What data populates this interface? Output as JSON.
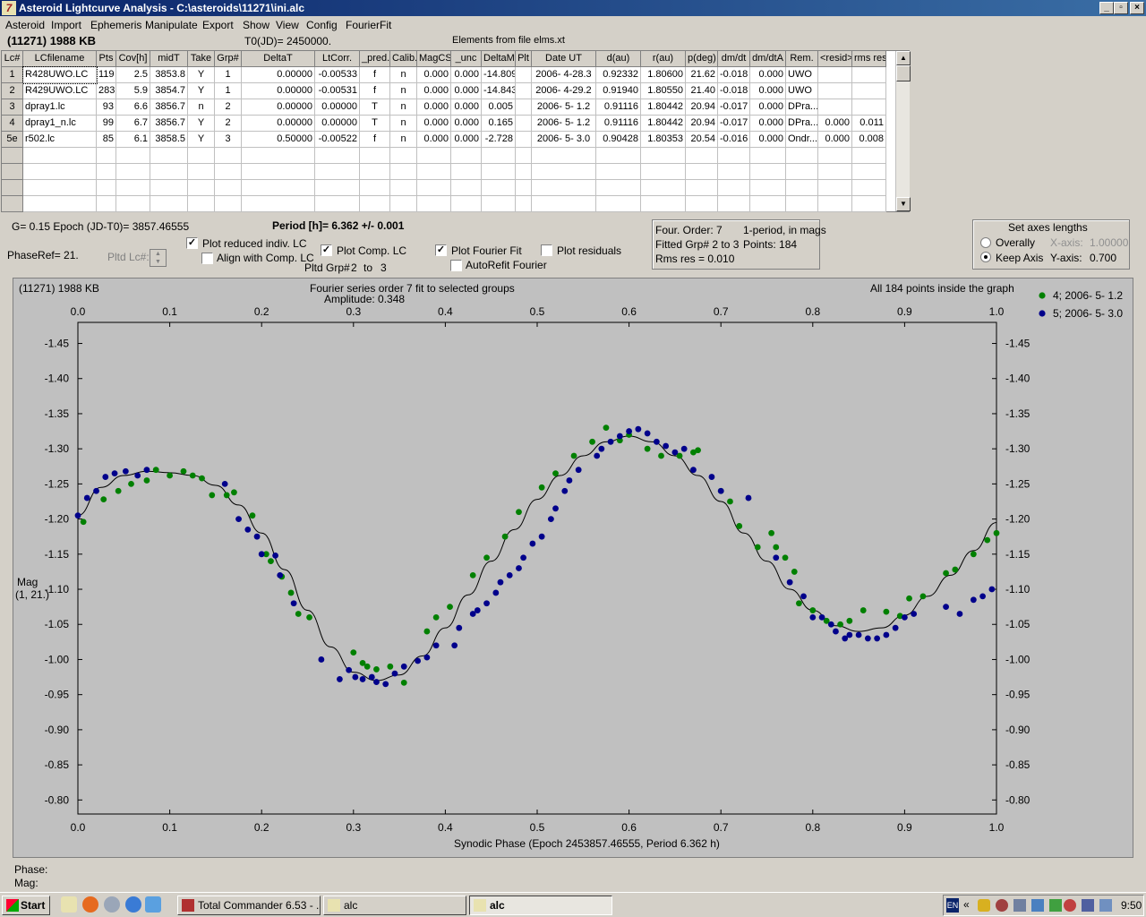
{
  "window": {
    "title": "Asteroid Lightcurve Analysis - C:\\asteroids\\11271\\ini.alc",
    "icon_glyph": "7",
    "btn_min": "_",
    "btn_max": "▫",
    "btn_close": "×"
  },
  "menu": [
    "Asteroid",
    "Import",
    "Ephemeris",
    "Manipulate",
    "Export",
    "Show",
    "View",
    "Config",
    "FourierFit"
  ],
  "header": {
    "object": "(11271) 1988 KB",
    "t0": "T0(JD)= 2450000.",
    "elements": "Elements from file elms.xt"
  },
  "table": {
    "columns": [
      "Lc#",
      "LCfilename",
      "Pts",
      "Cov[h]",
      "midT",
      "Take",
      "Grp#",
      "DeltaT",
      "LtCorr.",
      "_pred.",
      "Calib.",
      "MagCS",
      "_unc",
      "DeltaM",
      "Plt",
      "Date UT",
      "d(au)",
      "r(au)",
      "p(deg)",
      "dm/dt",
      "dm/dtA",
      "Rem.",
      "<resid>",
      "rms res"
    ],
    "rows": [
      [
        "1",
        "R428UWO.LC",
        "119",
        "2.5",
        "3853.8",
        "Y",
        "1",
        "0.00000",
        "-0.00533",
        "f",
        "n",
        "0.000",
        "0.000",
        "-14.809",
        "",
        "2006- 4-28.3",
        "0.92332",
        "1.80600",
        "21.62",
        "-0.018",
        "0.000",
        "UWO",
        "",
        ""
      ],
      [
        "2",
        "R429UWO.LC",
        "283",
        "5.9",
        "3854.7",
        "Y",
        "1",
        "0.00000",
        "-0.00531",
        "f",
        "n",
        "0.000",
        "0.000",
        "-14.843",
        "",
        "2006- 4-29.2",
        "0.91940",
        "1.80550",
        "21.40",
        "-0.018",
        "0.000",
        "UWO",
        "",
        ""
      ],
      [
        "3",
        "dpray1.lc",
        "93",
        "6.6",
        "3856.7",
        "n",
        "2",
        "0.00000",
        "0.00000",
        "T",
        "n",
        "0.000",
        "0.000",
        "0.005",
        "",
        "2006- 5- 1.2",
        "0.91116",
        "1.80442",
        "20.94",
        "-0.017",
        "0.000",
        "DPra...",
        "",
        ""
      ],
      [
        "4",
        "dpray1_n.lc",
        "99",
        "6.7",
        "3856.7",
        "Y",
        "2",
        "0.00000",
        "0.00000",
        "T",
        "n",
        "0.000",
        "0.000",
        "0.165",
        "",
        "2006- 5- 1.2",
        "0.91116",
        "1.80442",
        "20.94",
        "-0.017",
        "0.000",
        "DPra...",
        "0.000",
        "0.011"
      ],
      [
        "5e",
        "r502.lc",
        "85",
        "6.1",
        "3858.5",
        "Y",
        "3",
        "0.50000",
        "-0.00522",
        "f",
        "n",
        "0.000",
        "0.000",
        "-2.728",
        "",
        "2006- 5- 3.0",
        "0.90428",
        "1.80353",
        "20.54",
        "-0.016",
        "0.000",
        "Ondr...",
        "0.000",
        "0.008"
      ]
    ]
  },
  "controls": {
    "g_epoch": "G= 0.15    Epoch (JD-T0)= 3857.46555",
    "period": "Period [h]= 6.362 +/- 0.001",
    "phaseref": "PhaseRef= 21.",
    "pltd_lc": "Pltd Lc#:",
    "plot_reduced": "Plot reduced indiv. LC",
    "align_comp": "Align with Comp. LC",
    "plot_comp": "Plot Comp. LC",
    "pltd_grp": "Pltd Grp#",
    "grp_from": "2",
    "grp_to_word": "to",
    "grp_to": "3",
    "plot_fourier": "Plot Fourier Fit",
    "autorefit": "AutoRefit Fourier",
    "plot_residuals": "Plot residuals",
    "check_mark": "✓"
  },
  "fourier_box": {
    "order": "Four. Order:  7",
    "period_mode": "1-period, in mags",
    "fitted": "Fitted Grp# 2 to 3",
    "points": "Points: 184",
    "rms": "Rms res      = 0.010"
  },
  "axes_box": {
    "title": "Set axes lengths",
    "overally": "Overally",
    "keep_axis": "Keep Axis",
    "x_axis_label": "X-axis:",
    "x_axis_value": "1.00000",
    "y_axis_label": "Y-axis:",
    "y_axis_value": "0.700"
  },
  "plot_text": {
    "object": "(11271) 1988 KB",
    "fit_title": "Fourier series order 7 fit to selected groups",
    "amplitude": "Amplitude: 0.348",
    "inside": "All 184 points inside the graph",
    "y_label_1": "Mag",
    "y_label_2": "(1, 21.)",
    "x_label": "Synodic Phase (Epoch 2453857.46555, Period 6.362 h)"
  },
  "readout": {
    "phase": "Phase:",
    "mag": "Mag:"
  },
  "chart_data": {
    "type": "scatter",
    "title": "Fourier series order 7 fit to selected groups",
    "xlabel": "Synodic Phase (Epoch 2453857.46555, Period 6.362 h)",
    "ylabel": "Mag (1, 21.)",
    "xlim": [
      0.0,
      1.0
    ],
    "ylim": [
      -1.48,
      -0.78
    ],
    "y_inverted": true,
    "x_ticks": [
      "0.0",
      "0.1",
      "0.2",
      "0.3",
      "0.4",
      "0.5",
      "0.6",
      "0.7",
      "0.8",
      "0.9",
      "1.0"
    ],
    "y_ticks": [
      "-1.45",
      "-1.40",
      "-1.35",
      "-1.30",
      "-1.25",
      "-1.20",
      "-1.15",
      "-1.10",
      "-1.05",
      "-1.00",
      "-0.95",
      "-0.90",
      "-0.85",
      "-0.80"
    ],
    "grid": false,
    "legend_position": "top-right",
    "series": [
      {
        "name": "4; 2006- 5- 1.2",
        "color": "#008000",
        "x": [
          0.006,
          0.028,
          0.044,
          0.058,
          0.075,
          0.085,
          0.1,
          0.115,
          0.125,
          0.135,
          0.146,
          0.162,
          0.17,
          0.19,
          0.205,
          0.21,
          0.222,
          0.232,
          0.24,
          0.252,
          0.3,
          0.31,
          0.315,
          0.325,
          0.34,
          0.355,
          0.38,
          0.39,
          0.405,
          0.43,
          0.445,
          0.465,
          0.48,
          0.505,
          0.52,
          0.54,
          0.56,
          0.575,
          0.59,
          0.6,
          0.62,
          0.635,
          0.655,
          0.67,
          0.675,
          0.7,
          0.71,
          0.72,
          0.74,
          0.755,
          0.76,
          0.77,
          0.78,
          0.785,
          0.8,
          0.815,
          0.83,
          0.84,
          0.855,
          0.88,
          0.895,
          0.905,
          0.92,
          0.945,
          0.955,
          0.975,
          0.99,
          1.0
        ],
        "y": [
          -1.196,
          -1.228,
          -1.24,
          -1.25,
          -1.255,
          -1.27,
          -1.262,
          -1.268,
          -1.262,
          -1.258,
          -1.234,
          -1.234,
          -1.238,
          -1.205,
          -1.15,
          -1.14,
          -1.118,
          -1.095,
          -1.065,
          -1.06,
          -1.01,
          -0.995,
          -0.99,
          -0.986,
          -0.99,
          -0.967,
          -1.04,
          -1.06,
          -1.075,
          -1.12,
          -1.145,
          -1.175,
          -1.21,
          -1.245,
          -1.265,
          -1.29,
          -1.31,
          -1.33,
          -1.312,
          -1.32,
          -1.3,
          -1.29,
          -1.29,
          -1.295,
          -1.298,
          -1.24,
          -1.225,
          -1.19,
          -1.16,
          -1.18,
          -1.16,
          -1.145,
          -1.125,
          -1.08,
          -1.07,
          -1.055,
          -1.05,
          -1.055,
          -1.07,
          -1.068,
          -1.062,
          -1.087,
          -1.09,
          -1.123,
          -1.128,
          -1.15,
          -1.17,
          -1.18
        ]
      },
      {
        "name": "5; 2006- 5- 3.0",
        "color": "#00008b",
        "x": [
          0.0,
          0.01,
          0.02,
          0.03,
          0.04,
          0.052,
          0.065,
          0.075,
          0.16,
          0.175,
          0.185,
          0.195,
          0.2,
          0.215,
          0.22,
          0.235,
          0.265,
          0.285,
          0.295,
          0.302,
          0.31,
          0.32,
          0.325,
          0.335,
          0.345,
          0.355,
          0.37,
          0.38,
          0.39,
          0.41,
          0.415,
          0.43,
          0.435,
          0.445,
          0.455,
          0.46,
          0.47,
          0.48,
          0.485,
          0.495,
          0.505,
          0.515,
          0.52,
          0.53,
          0.535,
          0.545,
          0.565,
          0.57,
          0.58,
          0.59,
          0.6,
          0.61,
          0.62,
          0.63,
          0.64,
          0.65,
          0.66,
          0.67,
          0.69,
          0.7,
          0.73,
          0.76,
          0.775,
          0.79,
          0.8,
          0.81,
          0.82,
          0.825,
          0.835,
          0.84,
          0.85,
          0.86,
          0.87,
          0.88,
          0.89,
          0.9,
          0.91,
          0.945,
          0.96,
          0.975,
          0.985,
          0.995
        ],
        "y": [
          -1.205,
          -1.23,
          -1.24,
          -1.26,
          -1.265,
          -1.268,
          -1.262,
          -1.27,
          -1.25,
          -1.2,
          -1.185,
          -1.175,
          -1.15,
          -1.148,
          -1.12,
          -1.08,
          -1.0,
          -0.972,
          -0.985,
          -0.975,
          -0.972,
          -0.975,
          -0.968,
          -0.965,
          -0.98,
          -0.99,
          -0.998,
          -1.003,
          -1.02,
          -1.02,
          -1.045,
          -1.065,
          -1.07,
          -1.08,
          -1.095,
          -1.11,
          -1.12,
          -1.13,
          -1.145,
          -1.165,
          -1.175,
          -1.2,
          -1.215,
          -1.24,
          -1.255,
          -1.27,
          -1.29,
          -1.3,
          -1.31,
          -1.318,
          -1.325,
          -1.328,
          -1.322,
          -1.31,
          -1.304,
          -1.295,
          -1.3,
          -1.27,
          -1.26,
          -1.24,
          -1.23,
          -1.145,
          -1.11,
          -1.09,
          -1.06,
          -1.06,
          -1.05,
          -1.04,
          -1.03,
          -1.035,
          -1.035,
          -1.03,
          -1.03,
          -1.035,
          -1.045,
          -1.06,
          -1.065,
          -1.075,
          -1.065,
          -1.085,
          -1.09,
          -1.1
        ]
      }
    ],
    "fit_curve": {
      "name": "Fourier fit",
      "color": "#000000",
      "x": [
        0.0,
        0.025,
        0.05,
        0.075,
        0.1,
        0.125,
        0.15,
        0.175,
        0.2,
        0.225,
        0.25,
        0.275,
        0.3,
        0.325,
        0.35,
        0.375,
        0.4,
        0.425,
        0.45,
        0.475,
        0.5,
        0.525,
        0.55,
        0.575,
        0.6,
        0.625,
        0.65,
        0.675,
        0.7,
        0.725,
        0.75,
        0.775,
        0.8,
        0.825,
        0.85,
        0.875,
        0.9,
        0.925,
        0.95,
        0.975,
        1.0
      ],
      "y": [
        -1.205,
        -1.245,
        -1.262,
        -1.268,
        -1.266,
        -1.262,
        -1.248,
        -1.22,
        -1.18,
        -1.128,
        -1.07,
        -1.018,
        -0.982,
        -0.97,
        -0.978,
        -1.005,
        -1.045,
        -1.092,
        -1.14,
        -1.185,
        -1.228,
        -1.262,
        -1.29,
        -1.31,
        -1.318,
        -1.31,
        -1.29,
        -1.262,
        -1.225,
        -1.18,
        -1.14,
        -1.1,
        -1.07,
        -1.048,
        -1.04,
        -1.045,
        -1.063,
        -1.09,
        -1.12,
        -1.155,
        -1.195
      ]
    }
  }
}
